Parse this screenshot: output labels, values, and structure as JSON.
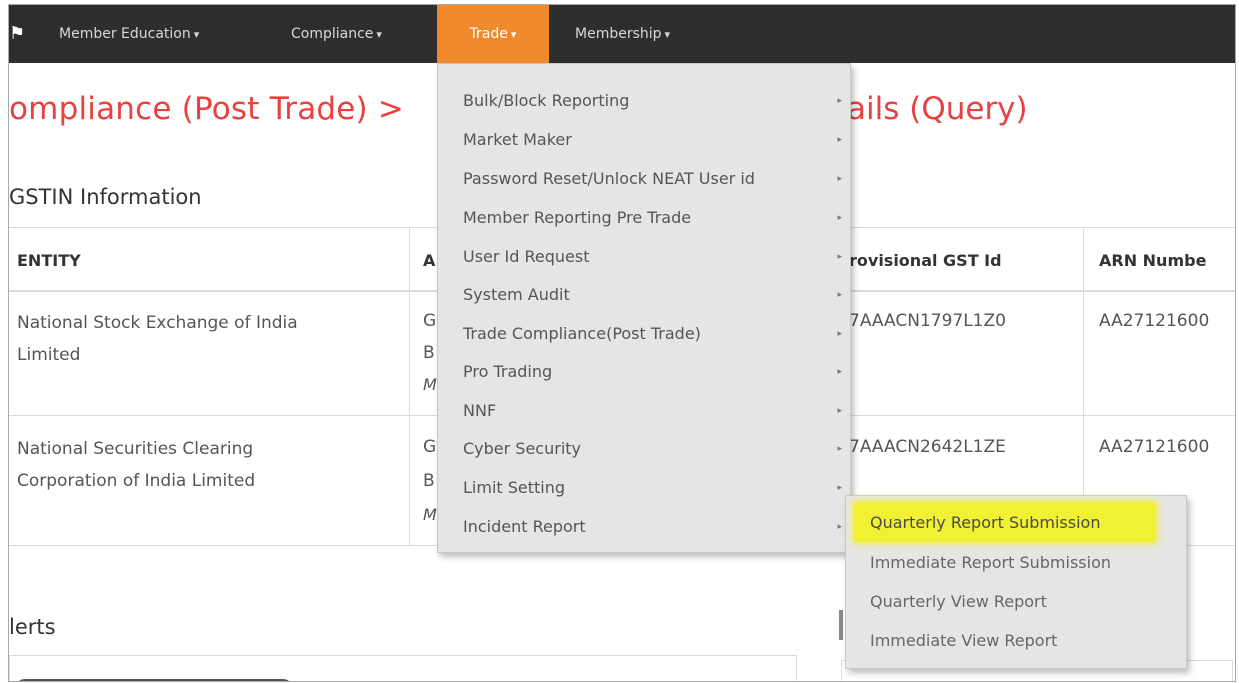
{
  "nav": {
    "home_icon": "⚑",
    "items": [
      {
        "label": "Member Education",
        "caret": "▾"
      },
      {
        "label": "Compliance",
        "caret": "▾"
      },
      {
        "label": "Trade",
        "caret": "▾"
      },
      {
        "label": "Membership",
        "caret": "▾"
      }
    ]
  },
  "page": {
    "title_left": "ompliance (Post Trade) >",
    "title_right": "ails (Query)",
    "section_title": "GSTIN Information"
  },
  "table": {
    "headers": [
      "ENTITY",
      "A",
      "rovisional GST Id",
      "ARN Numbe"
    ],
    "rows": [
      {
        "entity_line1": "National Stock Exchange of India",
        "entity_line2": "Limited",
        "addr_line1": "G",
        "addr_line2": "B",
        "addr_line3": "M",
        "gst_id": "7AAACN1797L1Z0",
        "arn": "AA27121600"
      },
      {
        "entity_line1": "National Securities Clearing",
        "entity_line2": "Corporation of India Limited",
        "addr_line1": "G",
        "addr_line2": "B",
        "addr_line3": "M",
        "gst_id": "7AAACN2642L1ZE",
        "arn": "AA27121600"
      }
    ]
  },
  "alerts": {
    "title": "lerts"
  },
  "trade_menu": {
    "arrow": "▸",
    "items": [
      "Bulk/Block Reporting",
      "Market Maker",
      "Password Reset/Unlock NEAT User id",
      "Member Reporting Pre Trade",
      "User Id Request",
      "System Audit",
      "Trade Compliance(Post Trade)",
      "Pro Trading",
      "NNF",
      "Cyber Security",
      "Limit Setting",
      "Incident Report"
    ]
  },
  "incident_submenu": {
    "items": [
      "Quarterly Report Submission",
      "Immediate Report Submission",
      "Quarterly View Report",
      "Immediate View Report"
    ],
    "highlight_color": "#f2f22a"
  },
  "colors": {
    "navbar": "#2e2e2e",
    "active_tab": "#f08a2c",
    "title_red": "#e8413f",
    "menu_bg": "#e5e5e5"
  }
}
